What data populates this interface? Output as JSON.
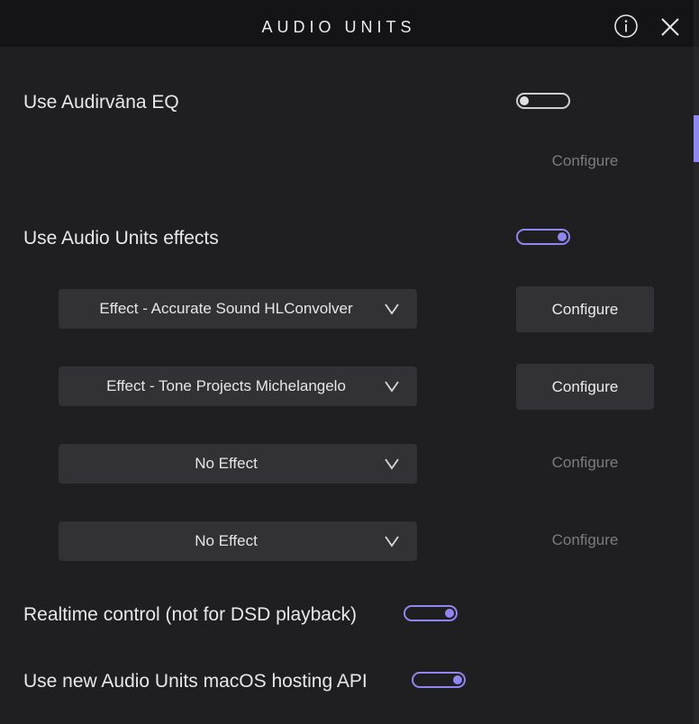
{
  "header": {
    "title": "AUDIO UNITS",
    "info_icon": "info-icon",
    "close_icon": "close-icon"
  },
  "eq": {
    "label": "Use Audirvāna EQ",
    "enabled": false,
    "configure_label": "Configure"
  },
  "au_effects": {
    "label": "Use Audio Units effects",
    "enabled": true,
    "slots": [
      {
        "selected": "Effect - Accurate Sound HLConvolver",
        "configure_label": "Configure",
        "configure_enabled": true
      },
      {
        "selected": "Effect - Tone Projects Michelangelo",
        "configure_label": "Configure",
        "configure_enabled": true
      },
      {
        "selected": "No Effect",
        "configure_label": "Configure",
        "configure_enabled": false
      },
      {
        "selected": "No Effect",
        "configure_label": "Configure",
        "configure_enabled": false
      }
    ]
  },
  "realtime": {
    "label": "Realtime control (not for DSD playback)",
    "enabled": true
  },
  "hosting_api": {
    "label": "Use new Audio Units macOS hosting API",
    "enabled": true
  },
  "colors": {
    "accent": "#8f86ef",
    "background": "#1f1f21",
    "header": "#141416",
    "control": "#323236"
  }
}
